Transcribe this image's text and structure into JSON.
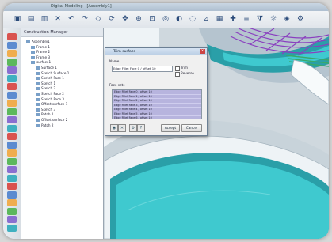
{
  "window": {
    "title": "Digital Modeling - [Assembly1]"
  },
  "toolbar_top": {
    "icons": [
      "open-icon",
      "save-icon",
      "print-icon",
      "delete-icon",
      "undo-icon",
      "redo-icon",
      "select-icon",
      "rotate-icon",
      "pan-icon",
      "zoom-icon",
      "fit-icon",
      "view-icon",
      "shade-icon",
      "wire-icon",
      "measure-icon",
      "grid-icon",
      "snap-icon",
      "layer-icon",
      "filter-icon",
      "light-icon",
      "render-icon",
      "settings-icon"
    ]
  },
  "tree": {
    "header": "Construction Manager",
    "items": [
      {
        "label": "Assembly1",
        "indent": 0
      },
      {
        "label": "Frame 1",
        "indent": 1
      },
      {
        "label": "Frame 2",
        "indent": 1
      },
      {
        "label": "Frame 3",
        "indent": 1
      },
      {
        "label": "surface1",
        "indent": 1
      },
      {
        "label": "Surface 1",
        "indent": 2
      },
      {
        "label": "Sketch Surface 1",
        "indent": 2
      },
      {
        "label": "Sketch Face 1",
        "indent": 2
      },
      {
        "label": "Sketch 1",
        "indent": 2
      },
      {
        "label": "Sketch 2",
        "indent": 2
      },
      {
        "label": "Sketch Face 2",
        "indent": 2
      },
      {
        "label": "Sketch Face 3",
        "indent": 2
      },
      {
        "label": "Offset surface 1",
        "indent": 2
      },
      {
        "label": "Sketch 3",
        "indent": 2
      },
      {
        "label": "Patch 1",
        "indent": 2
      },
      {
        "label": "Offset surface 2",
        "indent": 2
      },
      {
        "label": "Patch 2",
        "indent": 2
      }
    ]
  },
  "dialog": {
    "title": "Trim surface",
    "name_label": "Name",
    "name_value": "Edge Fillet Face 0 / offset 10",
    "check1_label": "Trim",
    "check2_label": "Reverse",
    "list_label": "Face sets",
    "list_items": [
      "Edge Fillet Face 0 / offset 10",
      "Edge Fillet Face 1 / offset 10",
      "Edge Fillet Face 2 / offset 10",
      "Edge Fillet Face 3 / offset 10",
      "Edge Fillet Face 4 / offset 10",
      "Edge Fillet Face 5 / offset 10",
      "Edge Fillet Face 6 / offset 10",
      "Edge Fillet Face 7 / offset 10"
    ],
    "ok_label": "Accept",
    "cancel_label": "Cancel"
  },
  "colors": {
    "surface_teal": "#3fc9cf",
    "surface_dark": "#2a9fa8",
    "curve_purple": "#8a3fbf",
    "accent_green": "#3aa86a"
  }
}
